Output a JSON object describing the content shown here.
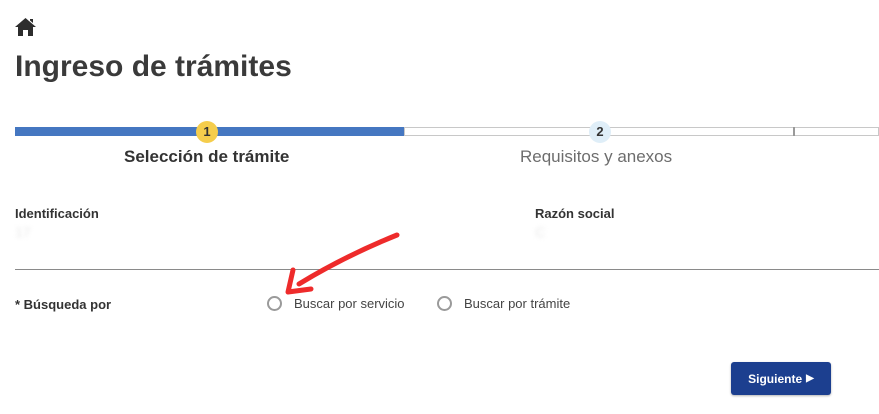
{
  "header": {
    "home_icon": "home-icon",
    "title": "Ingreso de trámites"
  },
  "stepper": {
    "steps": [
      {
        "number": "1",
        "label": "Selección de trámite",
        "state": "active",
        "color": "#f5cd4c"
      },
      {
        "number": "2",
        "label": "Requisitos y anexos",
        "state": "pending",
        "color": "#dfeef8"
      }
    ],
    "progress_color": "#4577c1"
  },
  "fields": {
    "identificacion": {
      "label": "Identificación",
      "value": "17"
    },
    "razon_social": {
      "label": "Razón social",
      "value": "C"
    }
  },
  "busqueda": {
    "label": "* Búsqueda por",
    "options": [
      {
        "label": "Buscar por servicio",
        "selected": false
      },
      {
        "label": "Buscar por trámite",
        "selected": false
      }
    ]
  },
  "annotation": {
    "arrow_color": "#ee2b2b",
    "points_to": "Buscar por servicio"
  },
  "actions": {
    "next_label": "Siguiente",
    "next_icon": "caret-right-icon",
    "next_color": "#1c3f8f"
  }
}
